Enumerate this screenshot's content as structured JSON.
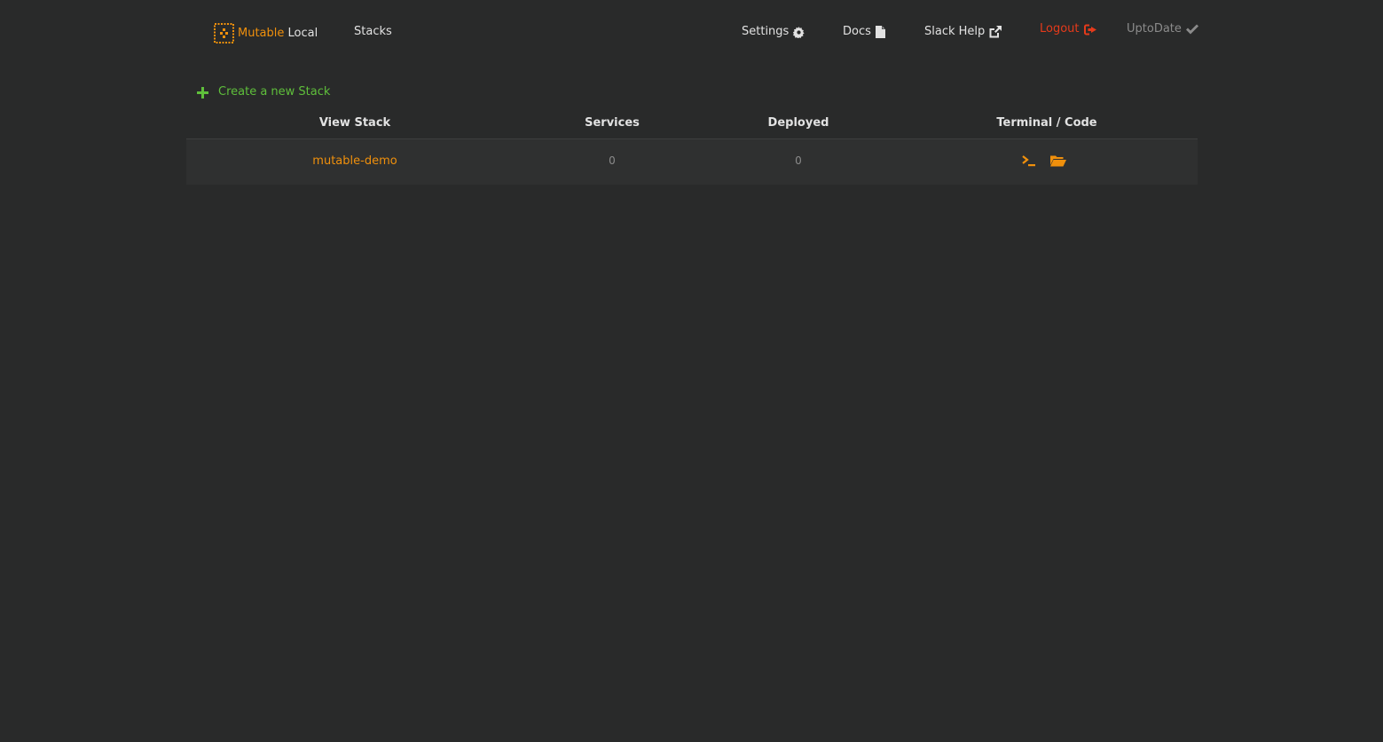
{
  "navbar": {
    "brand_mutable": "Mutable",
    "brand_local": "Local",
    "stacks": "Stacks",
    "settings": "Settings",
    "docs": "Docs",
    "slack_help": "Slack Help",
    "logout": "Logout",
    "uptodate": "UptoDate"
  },
  "actions": {
    "create_stack": "Create a new Stack"
  },
  "table": {
    "headers": [
      "View Stack",
      "Services",
      "Deployed",
      "Terminal / Code"
    ],
    "rows": [
      {
        "name": "mutable-demo",
        "services": "0",
        "deployed": "0"
      }
    ]
  },
  "icons": {
    "logo": "mutable-logo-icon",
    "settings": "gear-icon",
    "docs": "file-icon",
    "slack": "external-link-icon",
    "logout": "sign-out-icon",
    "uptodate": "check-icon",
    "create": "plus-icon",
    "terminal": "terminal-icon",
    "code": "folder-open-icon"
  },
  "colors": {
    "background": "#292a2a",
    "accent": "#f0900c",
    "logout": "#e53a1b",
    "create": "#5fbf3b",
    "muted": "#8b8b8b",
    "text": "#e2e2e2"
  }
}
